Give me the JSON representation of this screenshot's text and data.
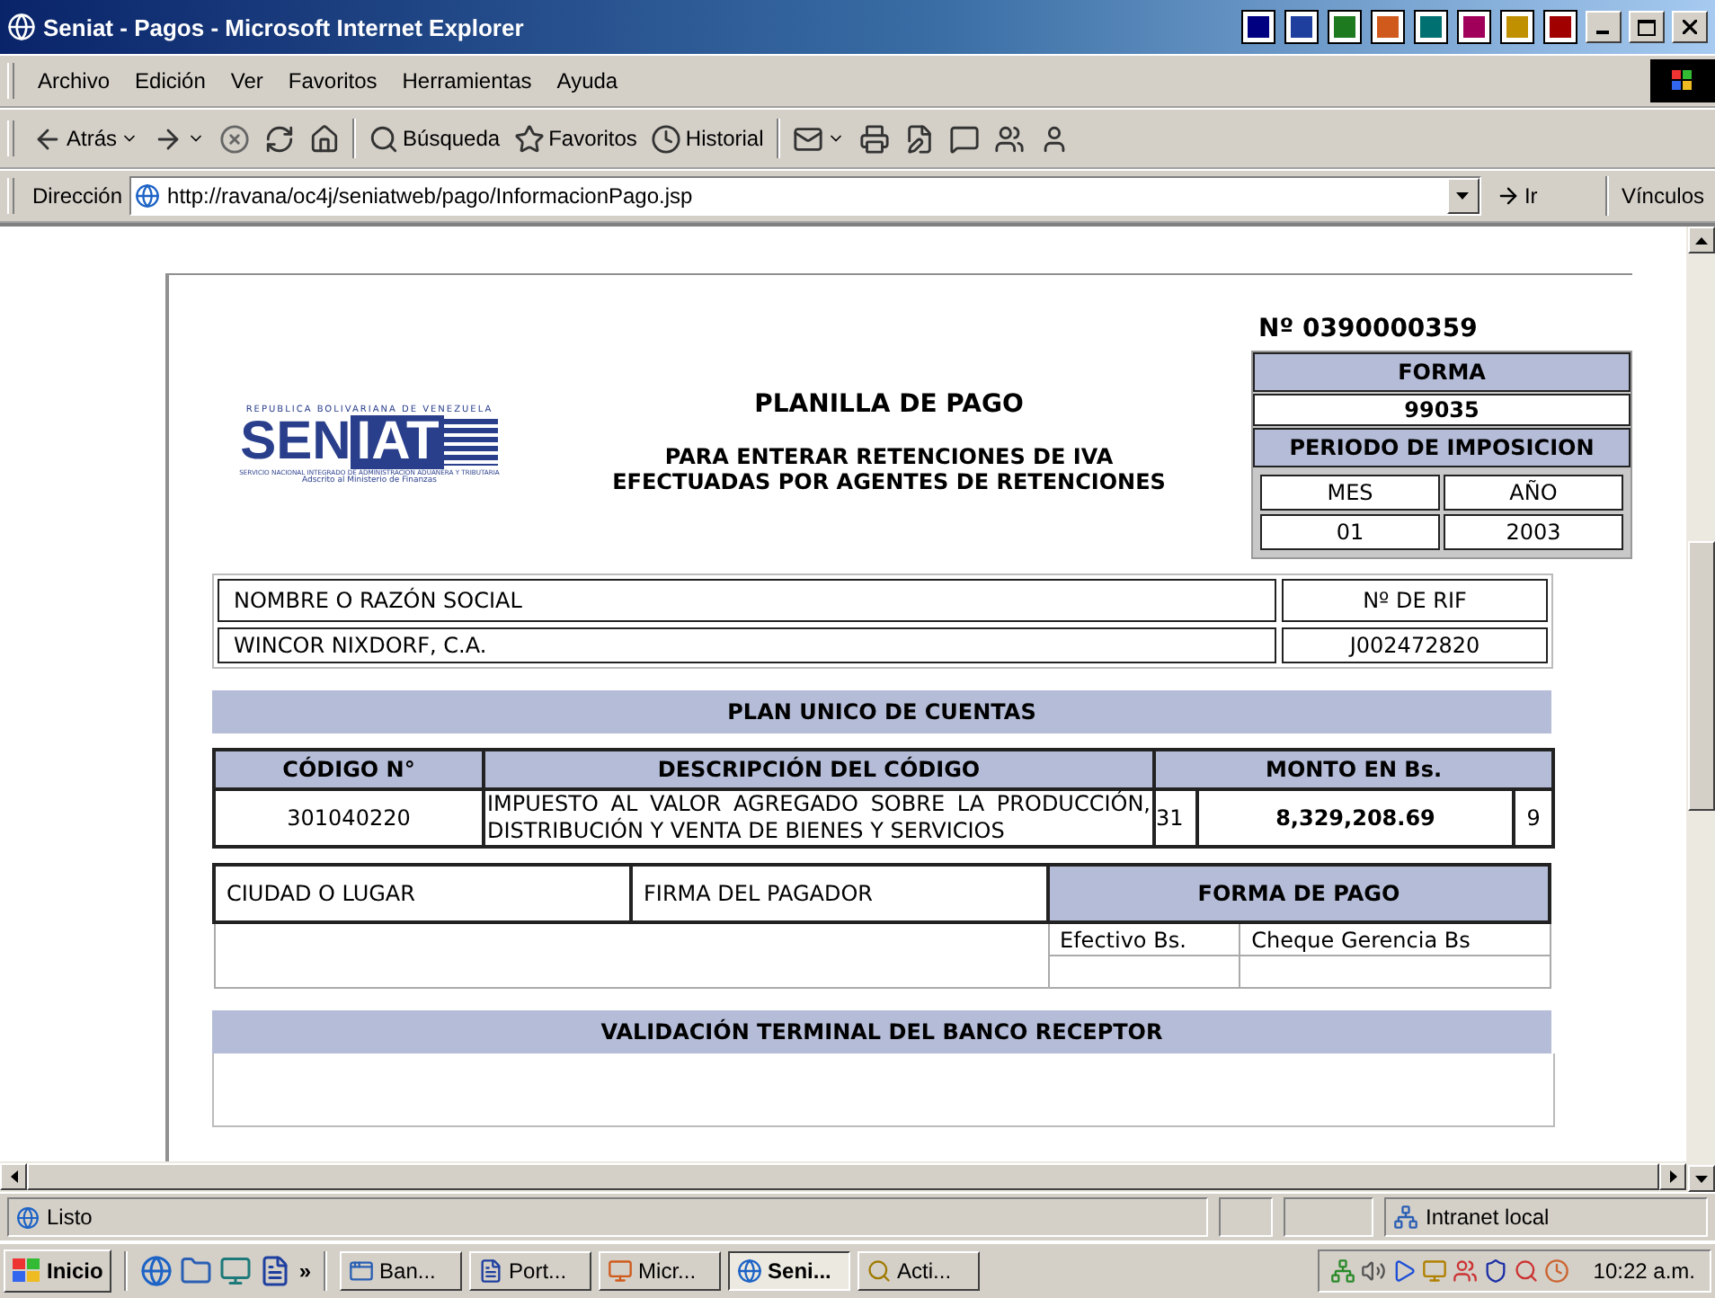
{
  "window": {
    "title": "Seniat - Pagos - Microsoft Internet Explorer"
  },
  "menu": [
    "Archivo",
    "Edición",
    "Ver",
    "Favoritos",
    "Herramientas",
    "Ayuda"
  ],
  "toolbar": [
    {
      "kind": "back",
      "label": "Atrás",
      "dropdown": true
    },
    {
      "kind": "forward",
      "dropdown": true
    },
    {
      "kind": "stop"
    },
    {
      "kind": "refresh"
    },
    {
      "kind": "home"
    },
    {
      "kind": "search",
      "label": "Búsqueda"
    },
    {
      "kind": "favorites",
      "label": "Favoritos"
    },
    {
      "kind": "history",
      "label": "Historial"
    },
    {
      "kind": "mail",
      "dropdown": true
    },
    {
      "kind": "print"
    },
    {
      "kind": "edit"
    },
    {
      "kind": "discuss"
    },
    {
      "kind": "messenger"
    },
    {
      "kind": "user"
    }
  ],
  "address": {
    "label": "Dirección",
    "url": "http://ravana/oc4j/seniatweb/pago/InformacionPago.jsp",
    "go": "Ir",
    "links": "Vínculos"
  },
  "form": {
    "logo": {
      "top": "REPUBLICA BOLIVARIANA DE VENEZUELA",
      "name_left": "SEN",
      "name_right": "IAT",
      "line": "SERVICIO NACIONAL INTEGRADO DE ADMINISTRACION ADUANERA Y TRIBUTARIA",
      "sub": "Adscrito al Ministerio de Finanzas"
    },
    "number": "Nº 0390000359",
    "title": "PLANILLA DE PAGO",
    "subtitle": [
      "PARA ENTERAR RETENCIONES DE IVA",
      "EFECTUADAS POR AGENTES DE RETENCIONES"
    ],
    "forma_label": "FORMA",
    "forma_value": "99035",
    "period_label": "PERIODO DE IMPOSICION",
    "period": {
      "month_label": "MES",
      "year_label": "AÑO",
      "month": "01",
      "year": "2003"
    },
    "taxpayer": {
      "name_label": "NOMBRE O RAZÓN SOCIAL",
      "rif_label": "Nº DE RIF",
      "name": "WINCOR NIXDORF, C.A.",
      "rif": "J002472820"
    },
    "plan_title": "PLAN UNICO DE CUENTAS",
    "accounts": {
      "columns": [
        "CÓDIGO N°",
        "DESCRIPCIÓN DEL CÓDIGO",
        "MONTO EN Bs."
      ],
      "rows": [
        {
          "code": "301040220",
          "description": "IMPUESTO AL VALOR AGREGADO SOBRE LA PRODUCCIÓN, DISTRIBUCIÓN Y VENTA DE BIENES Y SERVICIOS",
          "prefix": "31",
          "amount": "8,329,208.69",
          "suffix": "9"
        }
      ]
    },
    "city_label": "CIUDAD O LUGAR",
    "signature_label": "FIRMA DEL PAGADOR",
    "payment_label": "FORMA DE PAGO",
    "payment_columns": [
      "Efectivo Bs.",
      "Cheque Gerencia Bs"
    ],
    "validation_title": "VALIDACIÓN TERMINAL DEL BANCO RECEPTOR"
  },
  "status": {
    "text": "Listo",
    "zone": "Intranet local"
  },
  "taskbar": {
    "start": "Inicio",
    "more": "»",
    "tasks": [
      {
        "label": "Ban...",
        "kind": "app",
        "selected": false
      },
      {
        "label": "Port...",
        "kind": "word",
        "selected": false
      },
      {
        "label": "Micr...",
        "kind": "slides",
        "selected": false
      },
      {
        "label": "Seni...",
        "kind": "browser",
        "selected": true
      },
      {
        "label": "Acti...",
        "kind": "search",
        "selected": false
      }
    ],
    "clock": "10:22 a.m."
  }
}
